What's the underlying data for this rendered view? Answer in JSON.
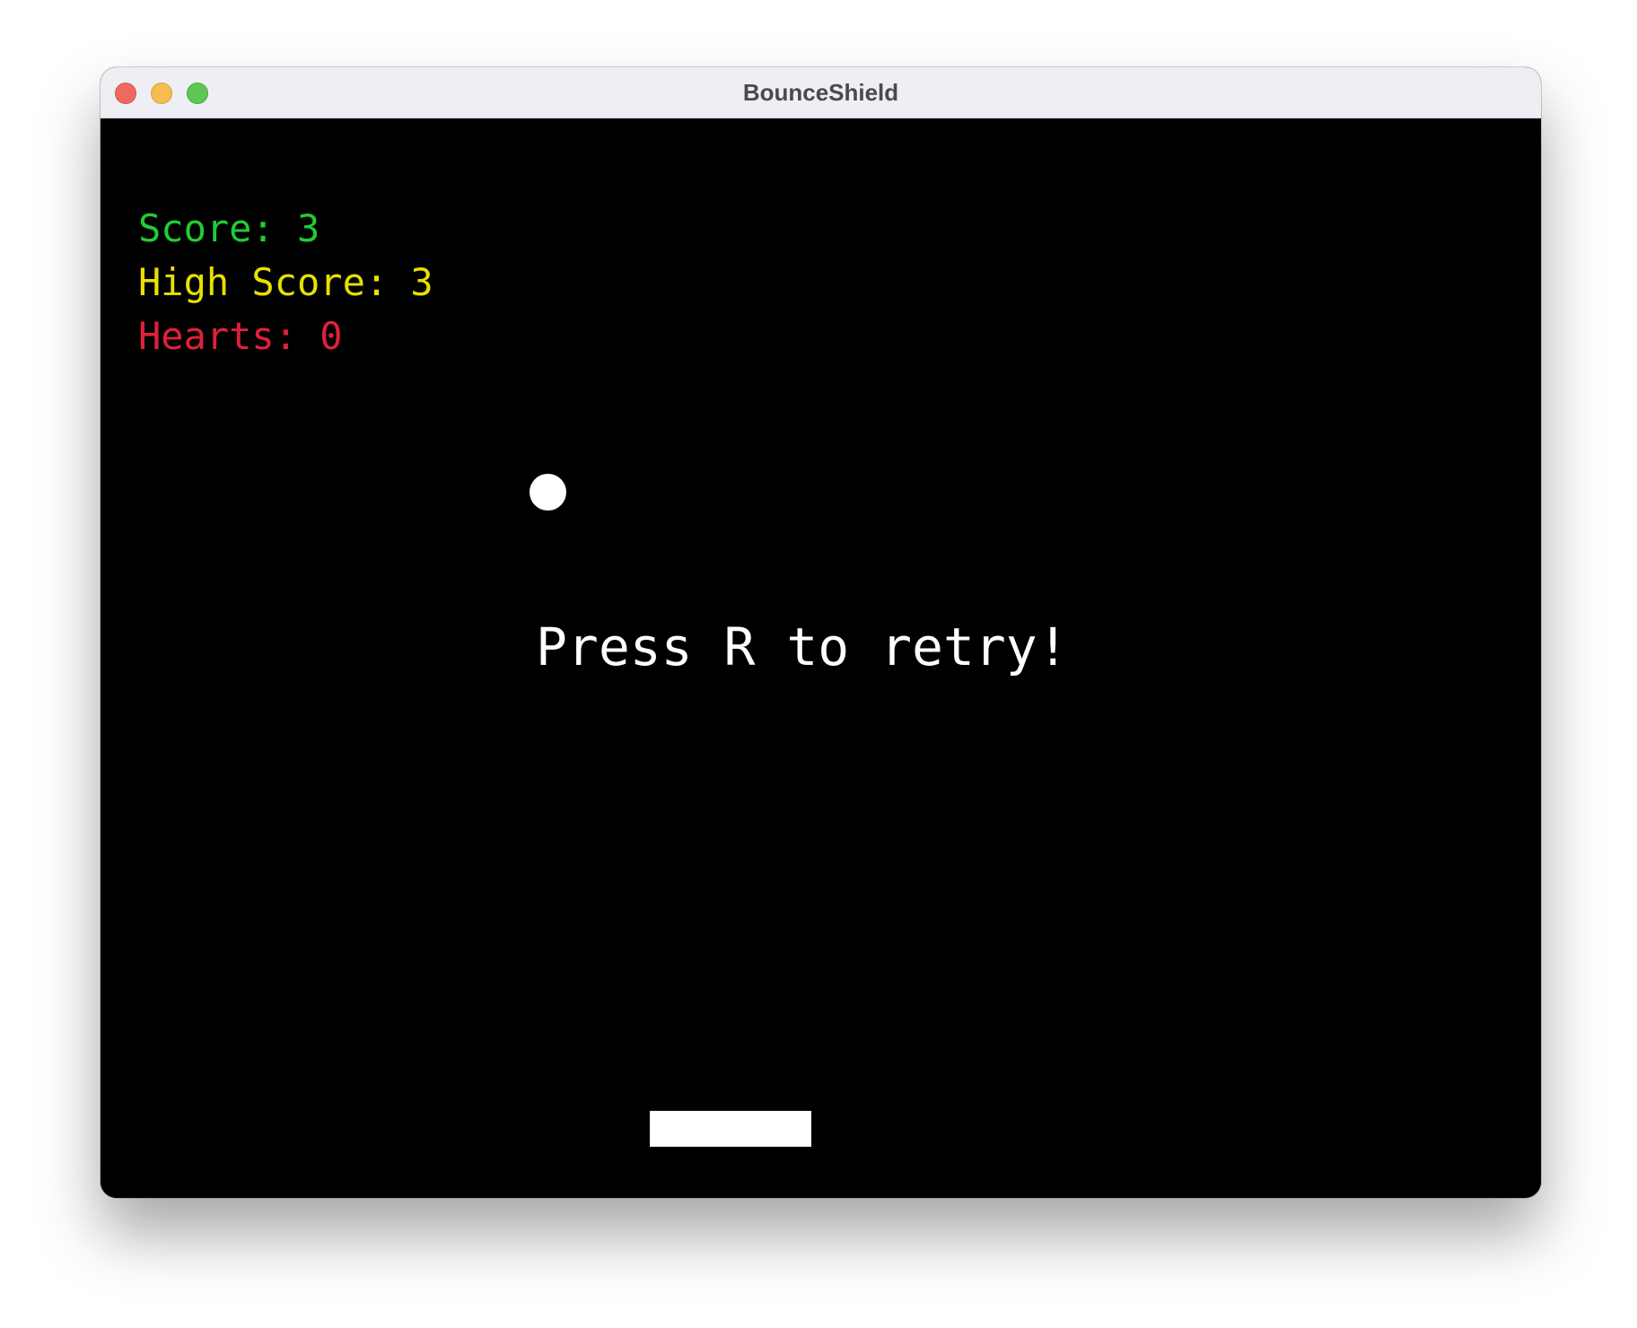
{
  "window": {
    "title": "BounceShield"
  },
  "hud": {
    "score": "Score: 3",
    "high_score": "High Score: 3",
    "hearts": "Hearts: 0"
  },
  "game": {
    "message": "Press R to retry!"
  },
  "colors": {
    "score": "#22cc33",
    "high_score": "#e8e000",
    "hearts": "#e0203a",
    "background": "#000000",
    "foreground": "#ffffff"
  }
}
